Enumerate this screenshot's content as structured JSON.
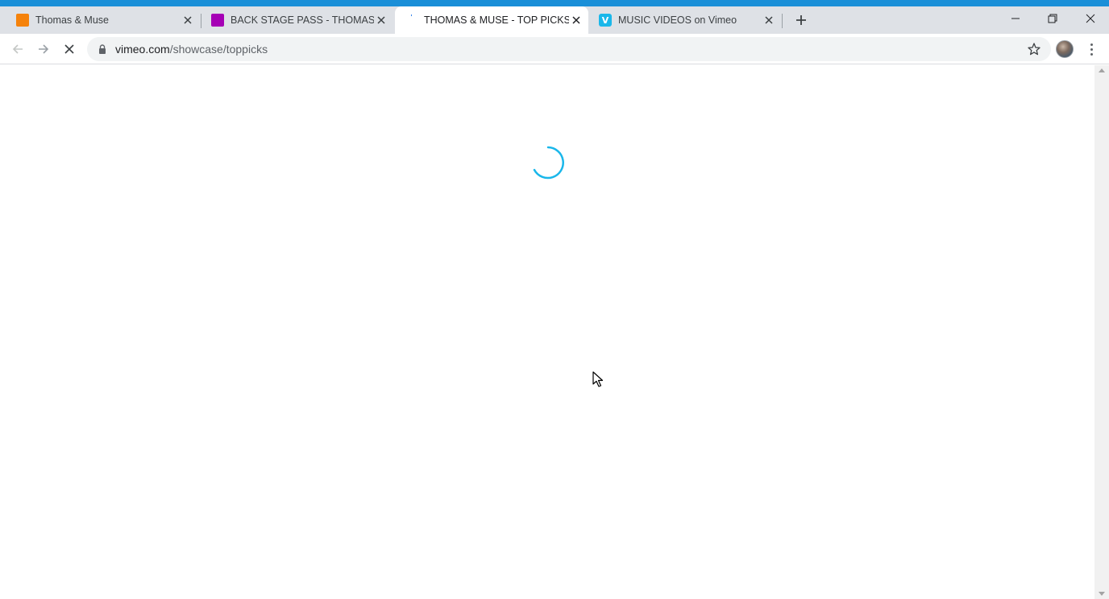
{
  "browser": {
    "tabs": [
      {
        "title": "Thomas & Muse",
        "favicon": "orange-square-icon",
        "active": false
      },
      {
        "title": "BACK STAGE PASS - THOMAS & MUSE",
        "favicon": "purple-square-icon",
        "active": false
      },
      {
        "title": "THOMAS & MUSE - TOP PICKS on Vimeo",
        "favicon": "loading-spinner-icon",
        "active": true
      },
      {
        "title": "MUSIC VIDEOS on Vimeo",
        "favicon": "vimeo-icon",
        "active": false
      }
    ],
    "vimeo_favicon_letter": "V",
    "address": {
      "host": "vimeo.com",
      "path": "/showcase/toppicks"
    }
  },
  "colors": {
    "accent_stripe": "#1a8fd8",
    "spinner": "#1ab7ea",
    "tab_bar": "#dee1e6",
    "vimeo_brand": "#1ab7ea"
  }
}
